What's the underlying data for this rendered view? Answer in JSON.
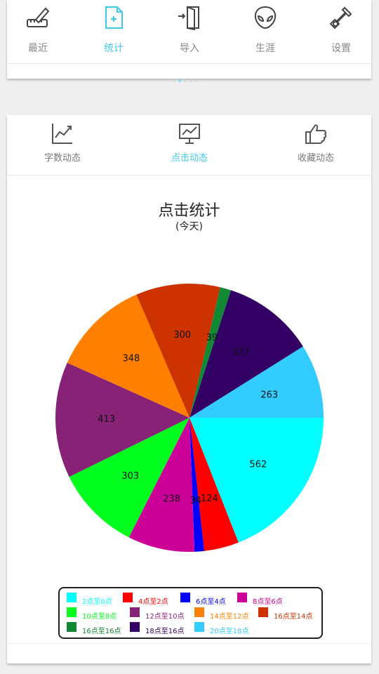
{
  "top_nav": {
    "items": [
      {
        "label": "最近",
        "icon": "recent-ruler-pencil-icon",
        "active": false
      },
      {
        "label": "统计",
        "icon": "statistics-document-icon",
        "active": true
      },
      {
        "label": "导入",
        "icon": "import-door-icon",
        "active": false
      },
      {
        "label": "生涯",
        "icon": "alien-head-icon",
        "active": false
      },
      {
        "label": "设置",
        "icon": "settings-wrench-icon",
        "active": false
      }
    ],
    "pager": {
      "count": 5,
      "active_index": 1
    }
  },
  "stats": {
    "tabs": [
      {
        "label": "字数动态",
        "icon": "line-chart-icon",
        "active": false
      },
      {
        "label": "点击动态",
        "icon": "presentation-board-icon",
        "active": true
      },
      {
        "label": "收藏动态",
        "icon": "thumbs-up-icon",
        "active": false
      }
    ]
  },
  "colors": {
    "accent": "#3ec8ee",
    "inactive": "#888888"
  },
  "chart_data": {
    "type": "pie",
    "title": "点击统计",
    "subtitle": "(今天)",
    "start_angle_deg": 0,
    "direction": "clockwise-on-screen",
    "slices": [
      {
        "label": "2点至0点",
        "value": 562,
        "color": "#00ffff"
      },
      {
        "label": "4点至2点",
        "value": 124,
        "color": "#ff0000"
      },
      {
        "label": "6点至4点",
        "value": 34,
        "color": "#0000ff"
      },
      {
        "label": "8点至6点",
        "value": 238,
        "color": "#cc0099"
      },
      {
        "label": "10点至8点",
        "value": 303,
        "color": "#00ff1e"
      },
      {
        "label": "12点至10点",
        "value": 413,
        "color": "#882277"
      },
      {
        "label": "14点至12点",
        "value": 348,
        "color": "#ff8000"
      },
      {
        "label": "16点至14点",
        "value": 300,
        "color": "#cc3300"
      },
      {
        "label": "16点至16点",
        "value": 39,
        "color": "#118833"
      },
      {
        "label": "18点至16点",
        "value": 327,
        "color": "#330066"
      },
      {
        "label": "20点至18点",
        "value": 263,
        "color": "#33ccff"
      }
    ],
    "legend_position": "bottom"
  }
}
